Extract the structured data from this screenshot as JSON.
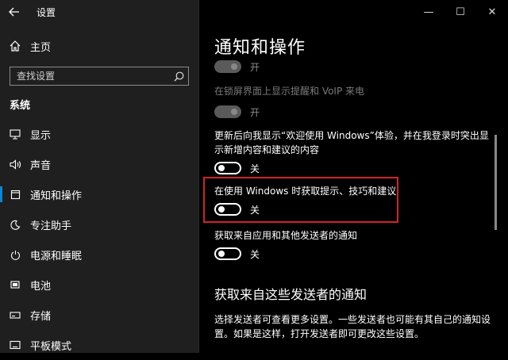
{
  "titlebar": {
    "app_title": "设置",
    "back_icon": "arrow-left-icon"
  },
  "window_controls": {
    "minimize": "—",
    "maximize": "☐",
    "close": "✕"
  },
  "sidebar": {
    "home_label": "主页",
    "search_placeholder": "查找设置",
    "section_header": "系统",
    "items": [
      {
        "label": "显示",
        "icon": "monitor-icon"
      },
      {
        "label": "声音",
        "icon": "speaker-icon"
      },
      {
        "label": "通知和操作",
        "icon": "notification-icon",
        "selected": true
      },
      {
        "label": "专注助手",
        "icon": "moon-icon"
      },
      {
        "label": "电源和睡眠",
        "icon": "power-icon"
      },
      {
        "label": "电池",
        "icon": "battery-icon"
      },
      {
        "label": "存储",
        "icon": "storage-icon"
      },
      {
        "label": "平板模式",
        "icon": "tablet-icon"
      }
    ]
  },
  "main": {
    "page_title": "通知和操作",
    "settings": [
      {
        "description": "",
        "state": "开",
        "on": true,
        "disabled": true
      },
      {
        "description": "在锁屏界面上显示提醒和 VoIP 来电",
        "state": "开",
        "on": true,
        "disabled": true
      },
      {
        "description": "更新后向我显示“欢迎使用 Windows”体验，并在我登录时突出显示新增内容和建议的内容",
        "state": "关",
        "on": false,
        "disabled": false
      },
      {
        "description": "在使用 Windows 时获取提示、技巧和建议",
        "state": "关",
        "on": false,
        "disabled": false,
        "highlighted": true
      },
      {
        "description": "获取来自应用和其他发送者的通知",
        "state": "关",
        "on": false,
        "disabled": false
      }
    ],
    "subheading": "获取来自这些发送者的通知",
    "paragraph": "选择发送者可查看更多设置。一些发送者也可能有其自己的通知设置。如果是这样，打开发送者即可更改这些设置。"
  },
  "colors": {
    "accent": "#0a84d6",
    "highlight_border": "#d02424"
  }
}
